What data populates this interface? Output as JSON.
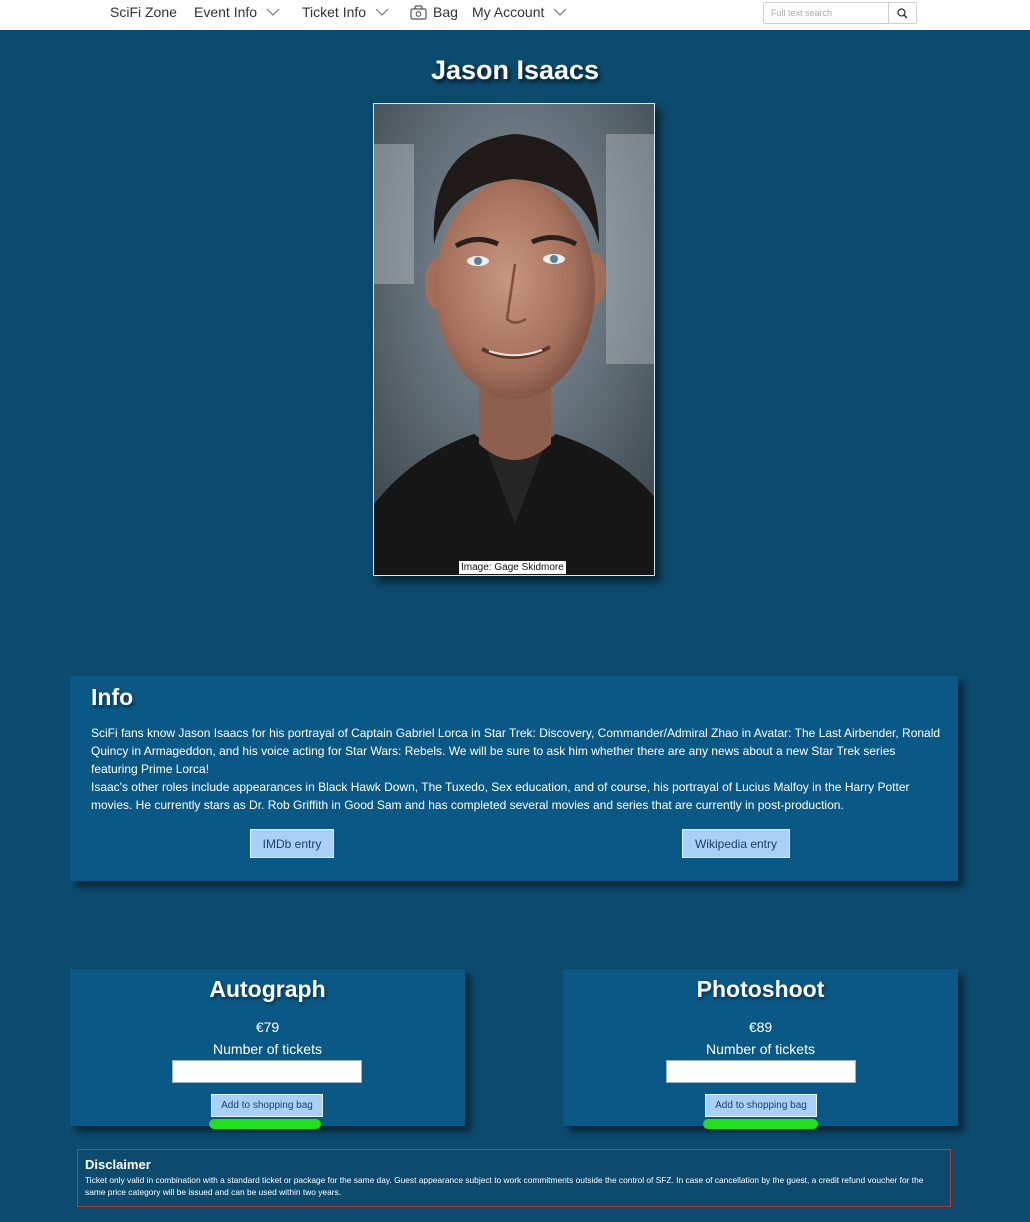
{
  "nav": {
    "brand": "SciFi Zone",
    "event_info": "Event Info",
    "ticket_info": "Ticket Info",
    "bag": "Bag",
    "my_account": "My Account",
    "search_placeholder": "Full text search",
    "search_value": "",
    "icons": {
      "bag": "bag-icon",
      "search": "search-icon",
      "dropdown": "chevron-down-icon"
    }
  },
  "hero": {
    "title": "Jason Isaacs",
    "photo_credit": "Image: Gage Skidmore"
  },
  "info": {
    "title": "Info",
    "paragraph_1": "SciFi fans know Jason Isaacs for his portrayal of Captain Gabriel Lorca in Star Trek: Discovery, Commander/Admiral Zhao in Avatar: The Last Airbender, Ronald Quincy in Armageddon, and his voice acting for Star Wars: Rebels. We will be sure to ask him whether there are any news about a new Star Trek series featuring Prime Lorca!",
    "paragraph_2": "Isaac's other roles include appearances in Black Hawk Down, The Tuxedo, Sex education, and of course, his portrayal of Lucius Malfoy in the Harry Potter movies. He currently stars as Dr. Rob Griffith in Good Sam and has completed several movies and series that are currently in post-production.",
    "imdb_button": "IMDb entry",
    "wikipedia_button": "Wikipedia entry"
  },
  "tickets": [
    {
      "title": "Autograph",
      "price": "€79",
      "qty_label": "Number of tickets",
      "qty_value": "",
      "add_button": "Add to shopping bag"
    },
    {
      "title": "Photoshoot",
      "price": "€89",
      "qty_label": "Number of tickets",
      "qty_value": "",
      "add_button": "Add to shopping bag"
    }
  ],
  "disclaimer": {
    "title": "Disclaimer",
    "text": "Ticket only valid in combination with a standard ticket or package for the same day. Guest appearance subject to work commitments outside the control of SFZ. In case of cancellation by the guest, a credit refund voucher for the same price category will be issued and can be used within two years."
  },
  "colors": {
    "page_background": "#0c4a6e",
    "card_background": "#0a5885",
    "button_background": "#a9d1f7",
    "focus_highlight": "#22e11a",
    "disclaimer_border": "#c0392b"
  }
}
